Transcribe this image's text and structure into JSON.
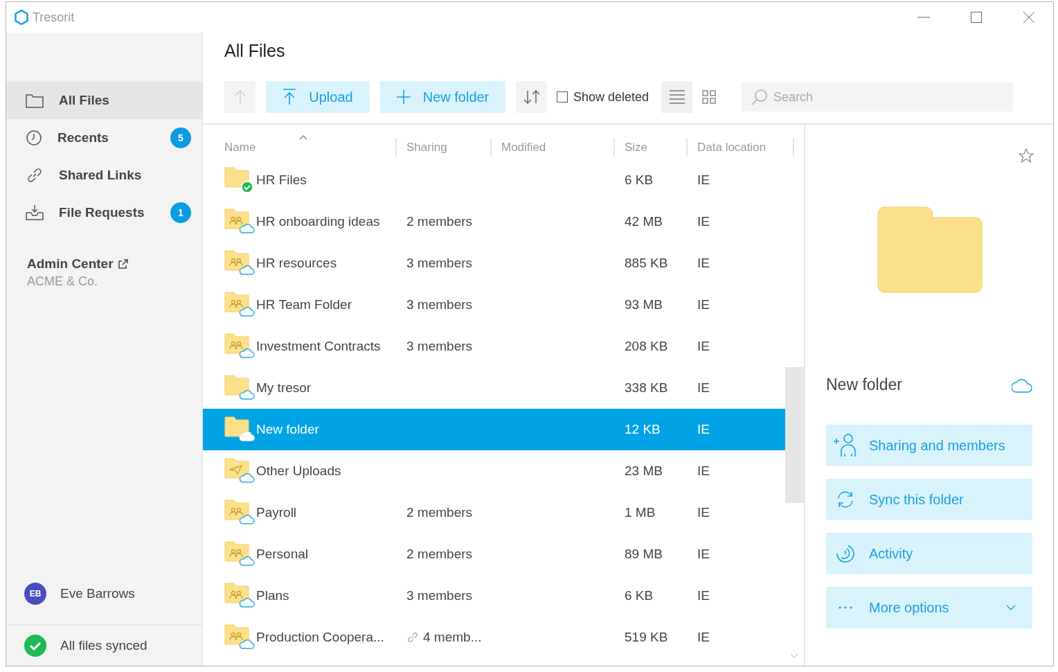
{
  "window": {
    "title": "Tresorit"
  },
  "sidebar": {
    "items": [
      {
        "label": "All Files",
        "selected": true
      },
      {
        "label": "Recents",
        "selected": false,
        "badge": "5"
      },
      {
        "label": "Shared Links",
        "selected": false
      },
      {
        "label": "File Requests",
        "selected": false,
        "badge": "1"
      }
    ],
    "admin": {
      "title": "Admin Center",
      "org": "ACME & Co."
    },
    "user": {
      "initials": "EB",
      "name": "Eve Barrows"
    },
    "status": "All files synced"
  },
  "page_title": "All Files",
  "toolbar": {
    "up_disabled": true,
    "upload": "Upload",
    "new_folder": "New folder",
    "show_deleted": {
      "label": "Show deleted",
      "checked": false
    },
    "views": [
      {
        "kind": "list",
        "selected": true
      },
      {
        "kind": "grid",
        "selected": false
      }
    ],
    "search": {
      "placeholder": "Search"
    }
  },
  "table": {
    "columns": [
      "Name",
      "Sharing",
      "Modified",
      "Size",
      "Data location"
    ],
    "rows": [
      {
        "name": "HR Files",
        "kind": "plain",
        "synced": true,
        "sharing": "",
        "linked": false,
        "size": "6 KB",
        "location": "IE",
        "selected": false
      },
      {
        "name": "HR onboarding ideas",
        "kind": "shared",
        "synced": false,
        "sharing": "2 members",
        "linked": false,
        "size": "42 MB",
        "location": "IE",
        "selected": false
      },
      {
        "name": "HR resources",
        "kind": "shared",
        "synced": false,
        "sharing": "3 members",
        "linked": false,
        "size": "885 KB",
        "location": "IE",
        "selected": false
      },
      {
        "name": "HR Team Folder",
        "kind": "shared",
        "synced": false,
        "sharing": "3 members",
        "linked": false,
        "size": "93 MB",
        "location": "IE",
        "selected": false
      },
      {
        "name": "Investment Contracts",
        "kind": "shared",
        "synced": false,
        "sharing": "3 members",
        "linked": false,
        "size": "208 KB",
        "location": "IE",
        "selected": false
      },
      {
        "name": "My tresor",
        "kind": "plain",
        "synced": false,
        "sharing": "",
        "linked": false,
        "size": "338 KB",
        "location": "IE",
        "selected": false
      },
      {
        "name": "New folder",
        "kind": "plain",
        "synced": false,
        "sharing": "",
        "linked": false,
        "size": "12 KB",
        "location": "IE",
        "selected": true
      },
      {
        "name": "Other Uploads",
        "kind": "upload",
        "synced": false,
        "sharing": "",
        "linked": false,
        "size": "23 MB",
        "location": "IE",
        "selected": false
      },
      {
        "name": "Payroll",
        "kind": "shared",
        "synced": false,
        "sharing": "2 members",
        "linked": false,
        "size": "1 MB",
        "location": "IE",
        "selected": false
      },
      {
        "name": "Personal",
        "kind": "shared",
        "synced": false,
        "sharing": "2 members",
        "linked": false,
        "size": "89 MB",
        "location": "IE",
        "selected": false
      },
      {
        "name": "Plans",
        "kind": "shared",
        "synced": false,
        "sharing": "3 members",
        "linked": false,
        "size": "6 KB",
        "location": "IE",
        "selected": false
      },
      {
        "name": "Production Coopera...",
        "kind": "shared",
        "synced": false,
        "sharing": "4 memb...",
        "linked": true,
        "size": "519 KB",
        "location": "IE",
        "selected": false
      }
    ]
  },
  "details": {
    "title": "New folder",
    "actions": [
      {
        "kind": "sharing",
        "label": "Sharing and members"
      },
      {
        "kind": "sync",
        "label": "Sync this folder"
      },
      {
        "kind": "activity",
        "label": "Activity"
      },
      {
        "kind": "more",
        "label": "More options"
      }
    ]
  }
}
